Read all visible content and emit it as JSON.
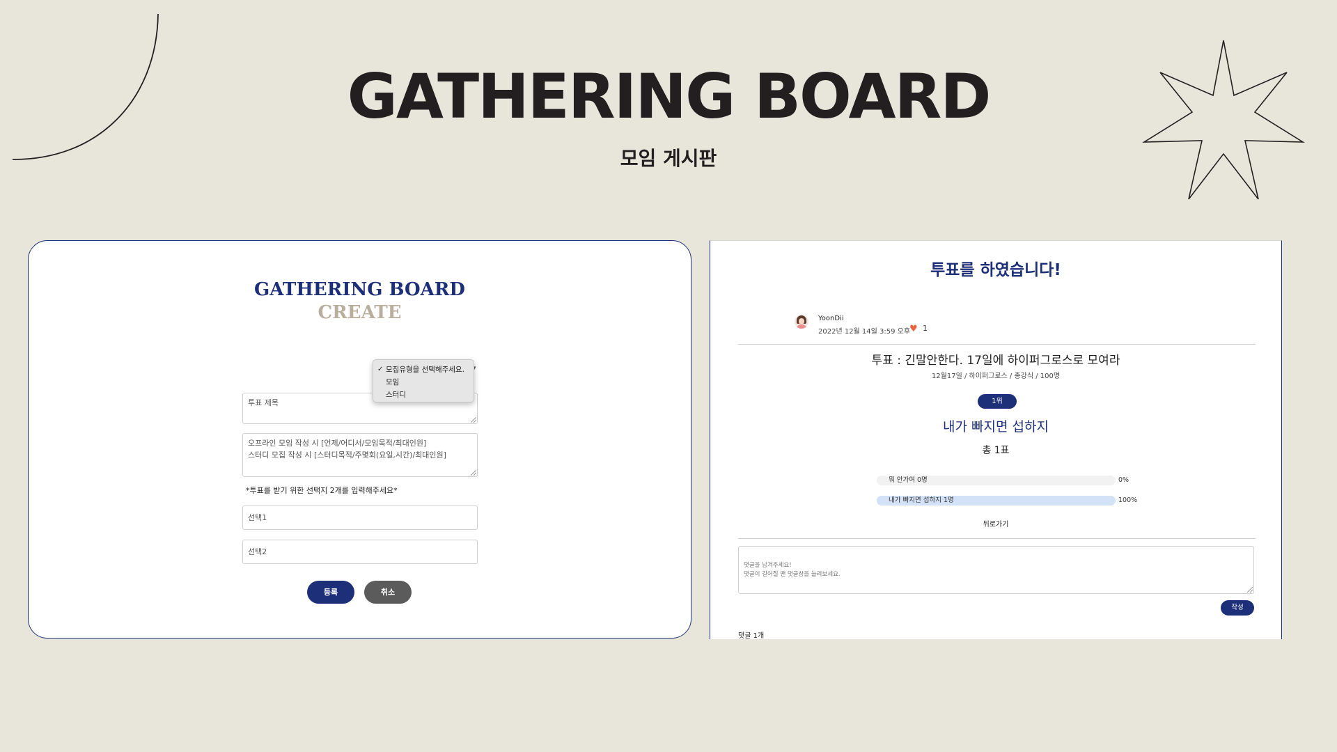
{
  "slide": {
    "title": "GATHERING BOARD",
    "subtitle": "모임 게시판"
  },
  "create_panel": {
    "title": "GATHERING BOARD",
    "subtitle": "CREATE",
    "type_select": {
      "options": [
        "모집유형을 선택해주세요.",
        "모임",
        "스터디"
      ],
      "selected": "모집유형을 선택해주세요."
    },
    "vote_title_placeholder": "투표 제목",
    "description_placeholder_line1": "오프라인 모임 작성 시 [언제/어디서/모임목적/최대인원]",
    "description_placeholder_line2": "스터디 모집 작성 시 [스터디목적/주몇회(요일,시간)/최대인원]",
    "hint": "*투표를 받기 위한 선택지 2개를 입력해주세요*",
    "choice1_placeholder": "선택1",
    "choice2_placeholder": "선택2",
    "submit_label": "등록",
    "cancel_label": "취소"
  },
  "result_panel": {
    "heading": "투표를 하였습니다!",
    "author": "YoonDii",
    "date": "2022년 12월 14일 3:59 오후",
    "likes": "1",
    "vote_title": "투표 : 긴말안한다. 17일에 하이퍼그로스로 모여라",
    "vote_meta": "12월17일 / 하이퍼그로스 / 종강식 / 100명",
    "rank_badge": "1위",
    "winner": "내가 빠지면 섭하지",
    "total": "총 1표",
    "results": [
      {
        "label": "뭐 안가여  0명",
        "percent_text": "0%",
        "fraction": 0
      },
      {
        "label": "내가 빠지면 섭하지  1명",
        "percent_text": "100%",
        "fraction": 1
      }
    ],
    "back_label": "뒤로가기",
    "comment_placeholder_line1": "댓글을 남겨주세요!",
    "comment_placeholder_line2": "댓글이 길어질 땐 댓글창을 늘려보세요.",
    "write_label": "작성",
    "comment_count": "댓글 1개"
  },
  "colors": {
    "background": "#e8e5da",
    "navy": "#1c2f78",
    "beige": "#b9ad9b",
    "heart": "#e8633f"
  }
}
